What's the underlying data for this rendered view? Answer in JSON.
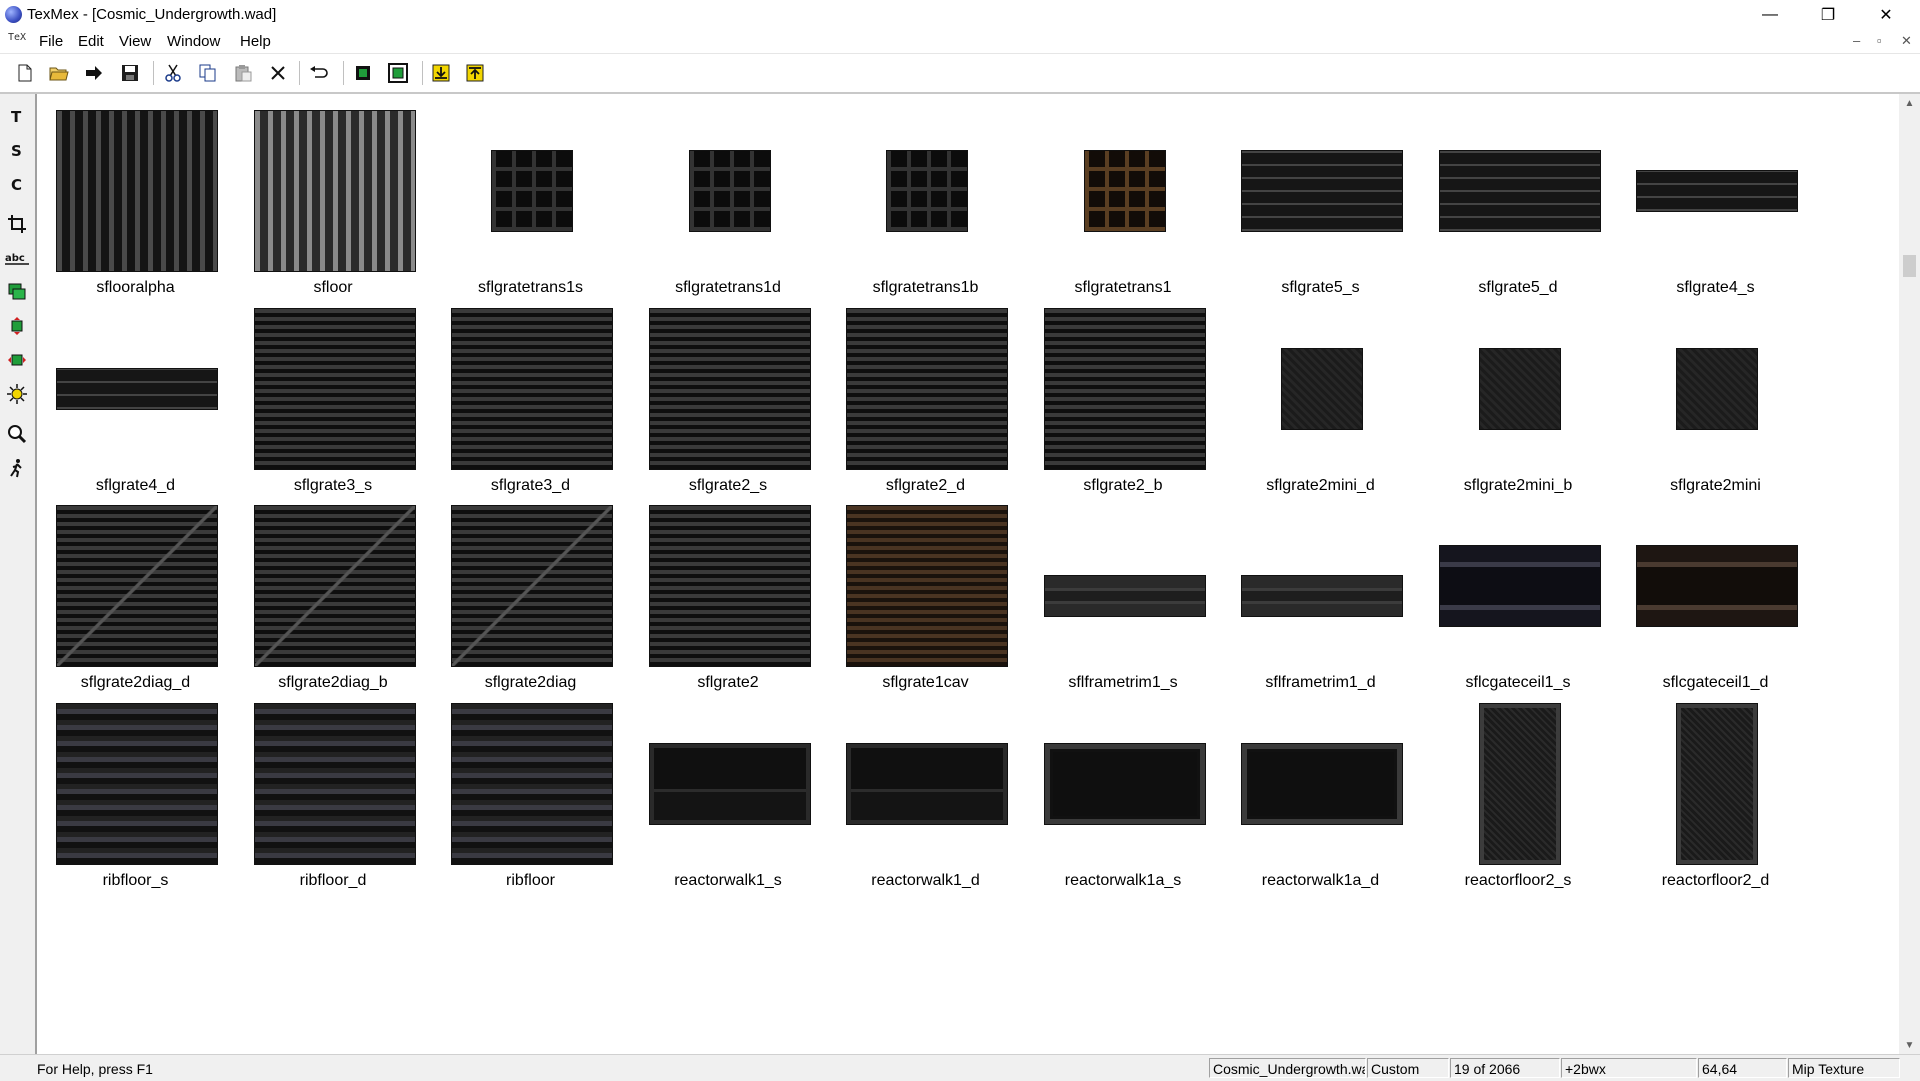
{
  "window": {
    "title": "TexMex - [Cosmic_Undergrowth.wad]",
    "minimize": "—",
    "restore": "❐",
    "close": "✕"
  },
  "menu": {
    "items": [
      "File",
      "Edit",
      "View",
      "Window",
      "Help"
    ],
    "app_icon": "TeX",
    "mdi": {
      "minimize": "–",
      "restore": "▫",
      "close": "✕"
    }
  },
  "toolbar": {
    "buttons": [
      "new-icon",
      "open-icon",
      "import-icon",
      "save-icon",
      "cut-icon",
      "copy-icon",
      "paste-icon",
      "delete-icon",
      "undo-icon",
      "select-icon",
      "fit-icon",
      "import-texture-icon",
      "export-texture-icon"
    ]
  },
  "left_tools": {
    "labels": [
      "T",
      "S",
      "C",
      "",
      "abc",
      "",
      "",
      "",
      "",
      "",
      ""
    ]
  },
  "textures": [
    {
      "name": "sflooralpha",
      "shape": "square"
    },
    {
      "name": "sfloor",
      "shape": "square"
    },
    {
      "name": "sflgratetrans1s",
      "shape": "small"
    },
    {
      "name": "sflgratetrans1d",
      "shape": "small"
    },
    {
      "name": "sflgratetrans1b",
      "shape": "small"
    },
    {
      "name": "sflgratetrans1",
      "shape": "small"
    },
    {
      "name": "sflgrate5_s",
      "shape": "wide"
    },
    {
      "name": "sflgrate5_d",
      "shape": "wide"
    },
    {
      "name": "sflgrate4_s",
      "shape": "strip"
    },
    {
      "name": "sflgrate4_d",
      "shape": "strip"
    },
    {
      "name": "sflgrate3_s",
      "shape": "square"
    },
    {
      "name": "sflgrate3_d",
      "shape": "square"
    },
    {
      "name": "sflgrate2_s",
      "shape": "square"
    },
    {
      "name": "sflgrate2_d",
      "shape": "square"
    },
    {
      "name": "sflgrate2_b",
      "shape": "square"
    },
    {
      "name": "sflgrate2mini_d",
      "shape": "small"
    },
    {
      "name": "sflgrate2mini_b",
      "shape": "small"
    },
    {
      "name": "sflgrate2mini",
      "shape": "small"
    },
    {
      "name": "sflgrate2diag_d",
      "shape": "square"
    },
    {
      "name": "sflgrate2diag_b",
      "shape": "square"
    },
    {
      "name": "sflgrate2diag",
      "shape": "square"
    },
    {
      "name": "sflgrate2",
      "shape": "square"
    },
    {
      "name": "sflgrate1cav",
      "shape": "square"
    },
    {
      "name": "sflframetrim1_s",
      "shape": "thin"
    },
    {
      "name": "sflframetrim1_d",
      "shape": "thin"
    },
    {
      "name": "sflcgateceil1_s",
      "shape": "wide"
    },
    {
      "name": "sflcgateceil1_d",
      "shape": "wide"
    },
    {
      "name": "ribfloor_s",
      "shape": "square"
    },
    {
      "name": "ribfloor_d",
      "shape": "square"
    },
    {
      "name": "ribfloor",
      "shape": "square"
    },
    {
      "name": "reactorwalk1_s",
      "shape": "wide"
    },
    {
      "name": "reactorwalk1_d",
      "shape": "wide"
    },
    {
      "name": "reactorwalk1a_s",
      "shape": "wide"
    },
    {
      "name": "reactorwalk1a_d",
      "shape": "wide"
    },
    {
      "name": "reactorfloor2_s",
      "shape": "tall"
    },
    {
      "name": "reactorfloor2_d",
      "shape": "tall"
    }
  ],
  "scrollbar": {
    "up": "▲",
    "down": "▼"
  },
  "status": {
    "help": "For Help, press F1",
    "file": "Cosmic_Undergrowth.wad",
    "mode": "Custom",
    "position": "19 of 2066",
    "prefix": "+2bwx",
    "size": "64,64",
    "type": "Mip Texture"
  }
}
